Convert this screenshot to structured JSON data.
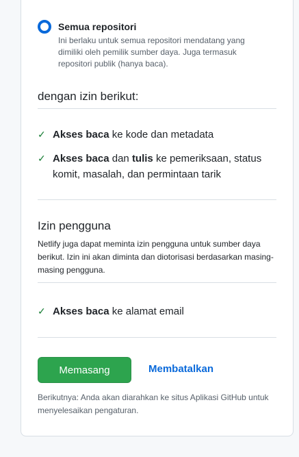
{
  "repository_access": {
    "option_label": "Semua repositori",
    "option_description": "Ini berlaku untuk semua repositori mendatang yang dimiliki oleh pemilik sumber daya. Juga termasuk repositori publik (hanya baca)."
  },
  "repo_permissions": {
    "heading": "dengan izin berikut:",
    "items": [
      {
        "icon": "check-icon",
        "part1_bold": "Akses baca",
        "part2": " ke kode dan metadata",
        "part3_bold": "",
        "part4": ""
      },
      {
        "icon": "check-icon",
        "part1_bold": "Akses baca",
        "part2": " dan ",
        "part3_bold": "tulis",
        "part4": " ke pemeriksaan, status komit, masalah, dan permintaan tarik"
      }
    ]
  },
  "user_permissions": {
    "heading": "Izin pengguna",
    "description": "Netlify juga dapat meminta izin pengguna untuk sumber daya berikut. Izin ini akan diminta dan diotorisasi berdasarkan masing-masing pengguna.",
    "items": [
      {
        "icon": "check-icon",
        "part1_bold": "Akses baca",
        "part2": " ke alamat email"
      }
    ]
  },
  "actions": {
    "install_label": "Memasang",
    "cancel_label": "Membatalkan",
    "next_note": "Berikutnya: Anda akan diarahkan ke situs Aplikasi GitHub untuk menyelesaikan pengaturan."
  },
  "colors": {
    "accent": "#0969da",
    "install_button": "#2da44e",
    "check": "#1a7f37"
  }
}
